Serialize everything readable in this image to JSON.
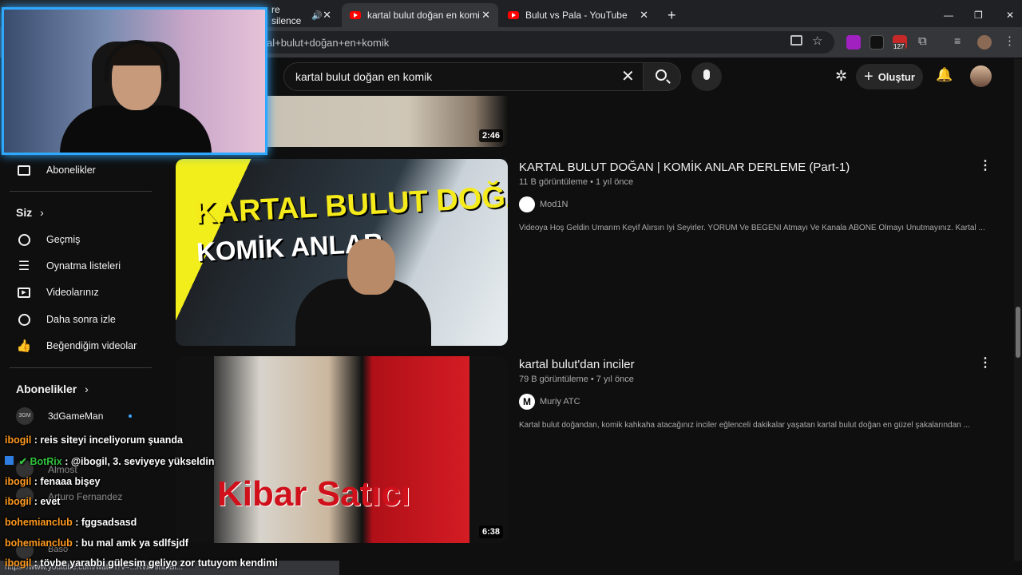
{
  "browser": {
    "tabs": [
      {
        "title": "re silence"
      },
      {
        "title": "kartal bulut doğan en komik - Y"
      },
      {
        "title": "Bulut vs Pala - YouTube"
      }
    ],
    "new_tab": "+",
    "close": "✕",
    "url": "al+bulut+doğan+en+komik",
    "extension_badge": "127",
    "window_controls": {
      "minimize": "—",
      "maximize": "❐",
      "close": "✕"
    }
  },
  "youtube": {
    "search_query": "kartal bulut doğan en komik",
    "create_label": "Oluştur"
  },
  "sidebar": {
    "subscriptions_link": "Abonelikler",
    "you_section": "Siz",
    "you_items": [
      {
        "label": "Geçmiş",
        "icon": "history-icon"
      },
      {
        "label": "Oynatma listeleri",
        "icon": "playlist-icon"
      },
      {
        "label": "Videolarınız",
        "icon": "your-videos-icon"
      },
      {
        "label": "Daha sonra izle",
        "icon": "watch-later-icon"
      },
      {
        "label": "Beğendiğim videolar",
        "icon": "liked-icon"
      }
    ],
    "subs_section": "Abonelikler",
    "channels": [
      {
        "name": "3dGameMan",
        "avatar_text": "3GM"
      },
      {
        "name": "Almost"
      },
      {
        "name": "Arturo Fernandez"
      },
      {
        "name": "Baso"
      }
    ]
  },
  "results": [
    {
      "duration": "2:46"
    },
    {
      "title": "KARTAL BULUT DOĞAN | KOMİK ANLAR DERLEME (Part-1)",
      "meta": "11 B görüntüleme • 1 yıl önce",
      "channel": "Mod1N",
      "description": "Videoya Hoş Geldin Umarım Keyif Alırsın İyi Seyirler. YORUM Ve BEĞENİ Atmayı Ve Kanala ABONE Olmayı Unutmayınız. Kartal ...",
      "thumb_line1": "KARTAL BULUT DOĞAN",
      "thumb_line2": "KOMİK ANLAR"
    },
    {
      "title": "kartal bulut'dan inciler",
      "meta": "79 B görüntüleme • 7 yıl önce",
      "channel": "Muriy ATC",
      "channel_initial": "M",
      "description": "Kartal bulut doğandan, komik kahkaha atacağınız inciler eğlenceli dakikalar yaşatan kartal bulut doğan en güzel şakalarından ...",
      "duration": "6:38",
      "thumb_text": "Kibar Satıcı"
    }
  ],
  "chat": [
    {
      "user": "ibogil",
      "msg": " : reis siteyi inceliyorum şuanda"
    },
    {
      "user": "BotRix",
      "msg": " : @ibogil, 3. seviyeye yükseldin",
      "bot": true
    },
    {
      "user": "ibogil",
      "msg": " : fenaaa bişey"
    },
    {
      "user": "ibogil",
      "msg": " : evet"
    },
    {
      "user": "bohemianclub",
      "msg": " : fggsadsasd"
    },
    {
      "user": "bohemianclub",
      "msg": " : bu mal amk ya sdlfsjdf"
    },
    {
      "user": "ibogil",
      "msg": " : tövbe yarabbi gülesim geliyo zor tutuyom kendimi"
    }
  ],
  "status_url": "https://www.youtube.com/watch?v=...RvxJ9hbiBl...",
  "colors": {
    "accent": "#2fa8ff",
    "chat_user": "#ff9a1f",
    "chat_bot": "#32c23c",
    "yt_red": "#ff0000"
  }
}
